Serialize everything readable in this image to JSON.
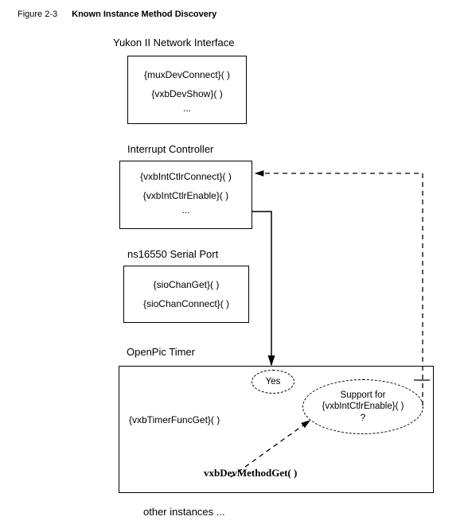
{
  "figure": {
    "number": "Figure 2-3",
    "title": "Known Instance Method Discovery"
  },
  "sections": {
    "yukon": "Yukon II Network Interface",
    "intctlr": "Interrupt Controller",
    "serial": "ns16550 Serial Port",
    "timer": "OpenPic Timer",
    "other": "other instances ..."
  },
  "boxes": {
    "yukon": {
      "line1": "{muxDevConnect}( )",
      "line2": "{vxbDevShow}( )",
      "ellipsis": "..."
    },
    "intctlr": {
      "line1": "{vxbIntCtlrConnect}( )",
      "line2": "{vxbIntCtlrEnable}( )",
      "ellipsis": "..."
    },
    "serial": {
      "line1": "{sioChanGet}( )",
      "line2": "{sioChanConnect}( )"
    },
    "timer": {
      "line1": "{vxbTimerFuncGet}( )"
    }
  },
  "labels": {
    "yes": "Yes",
    "support1": "Support for",
    "support2": "{vxbIntCtlrEnable}( )",
    "support3": "?",
    "methodGet": "vxbDevMethodGet( )"
  }
}
